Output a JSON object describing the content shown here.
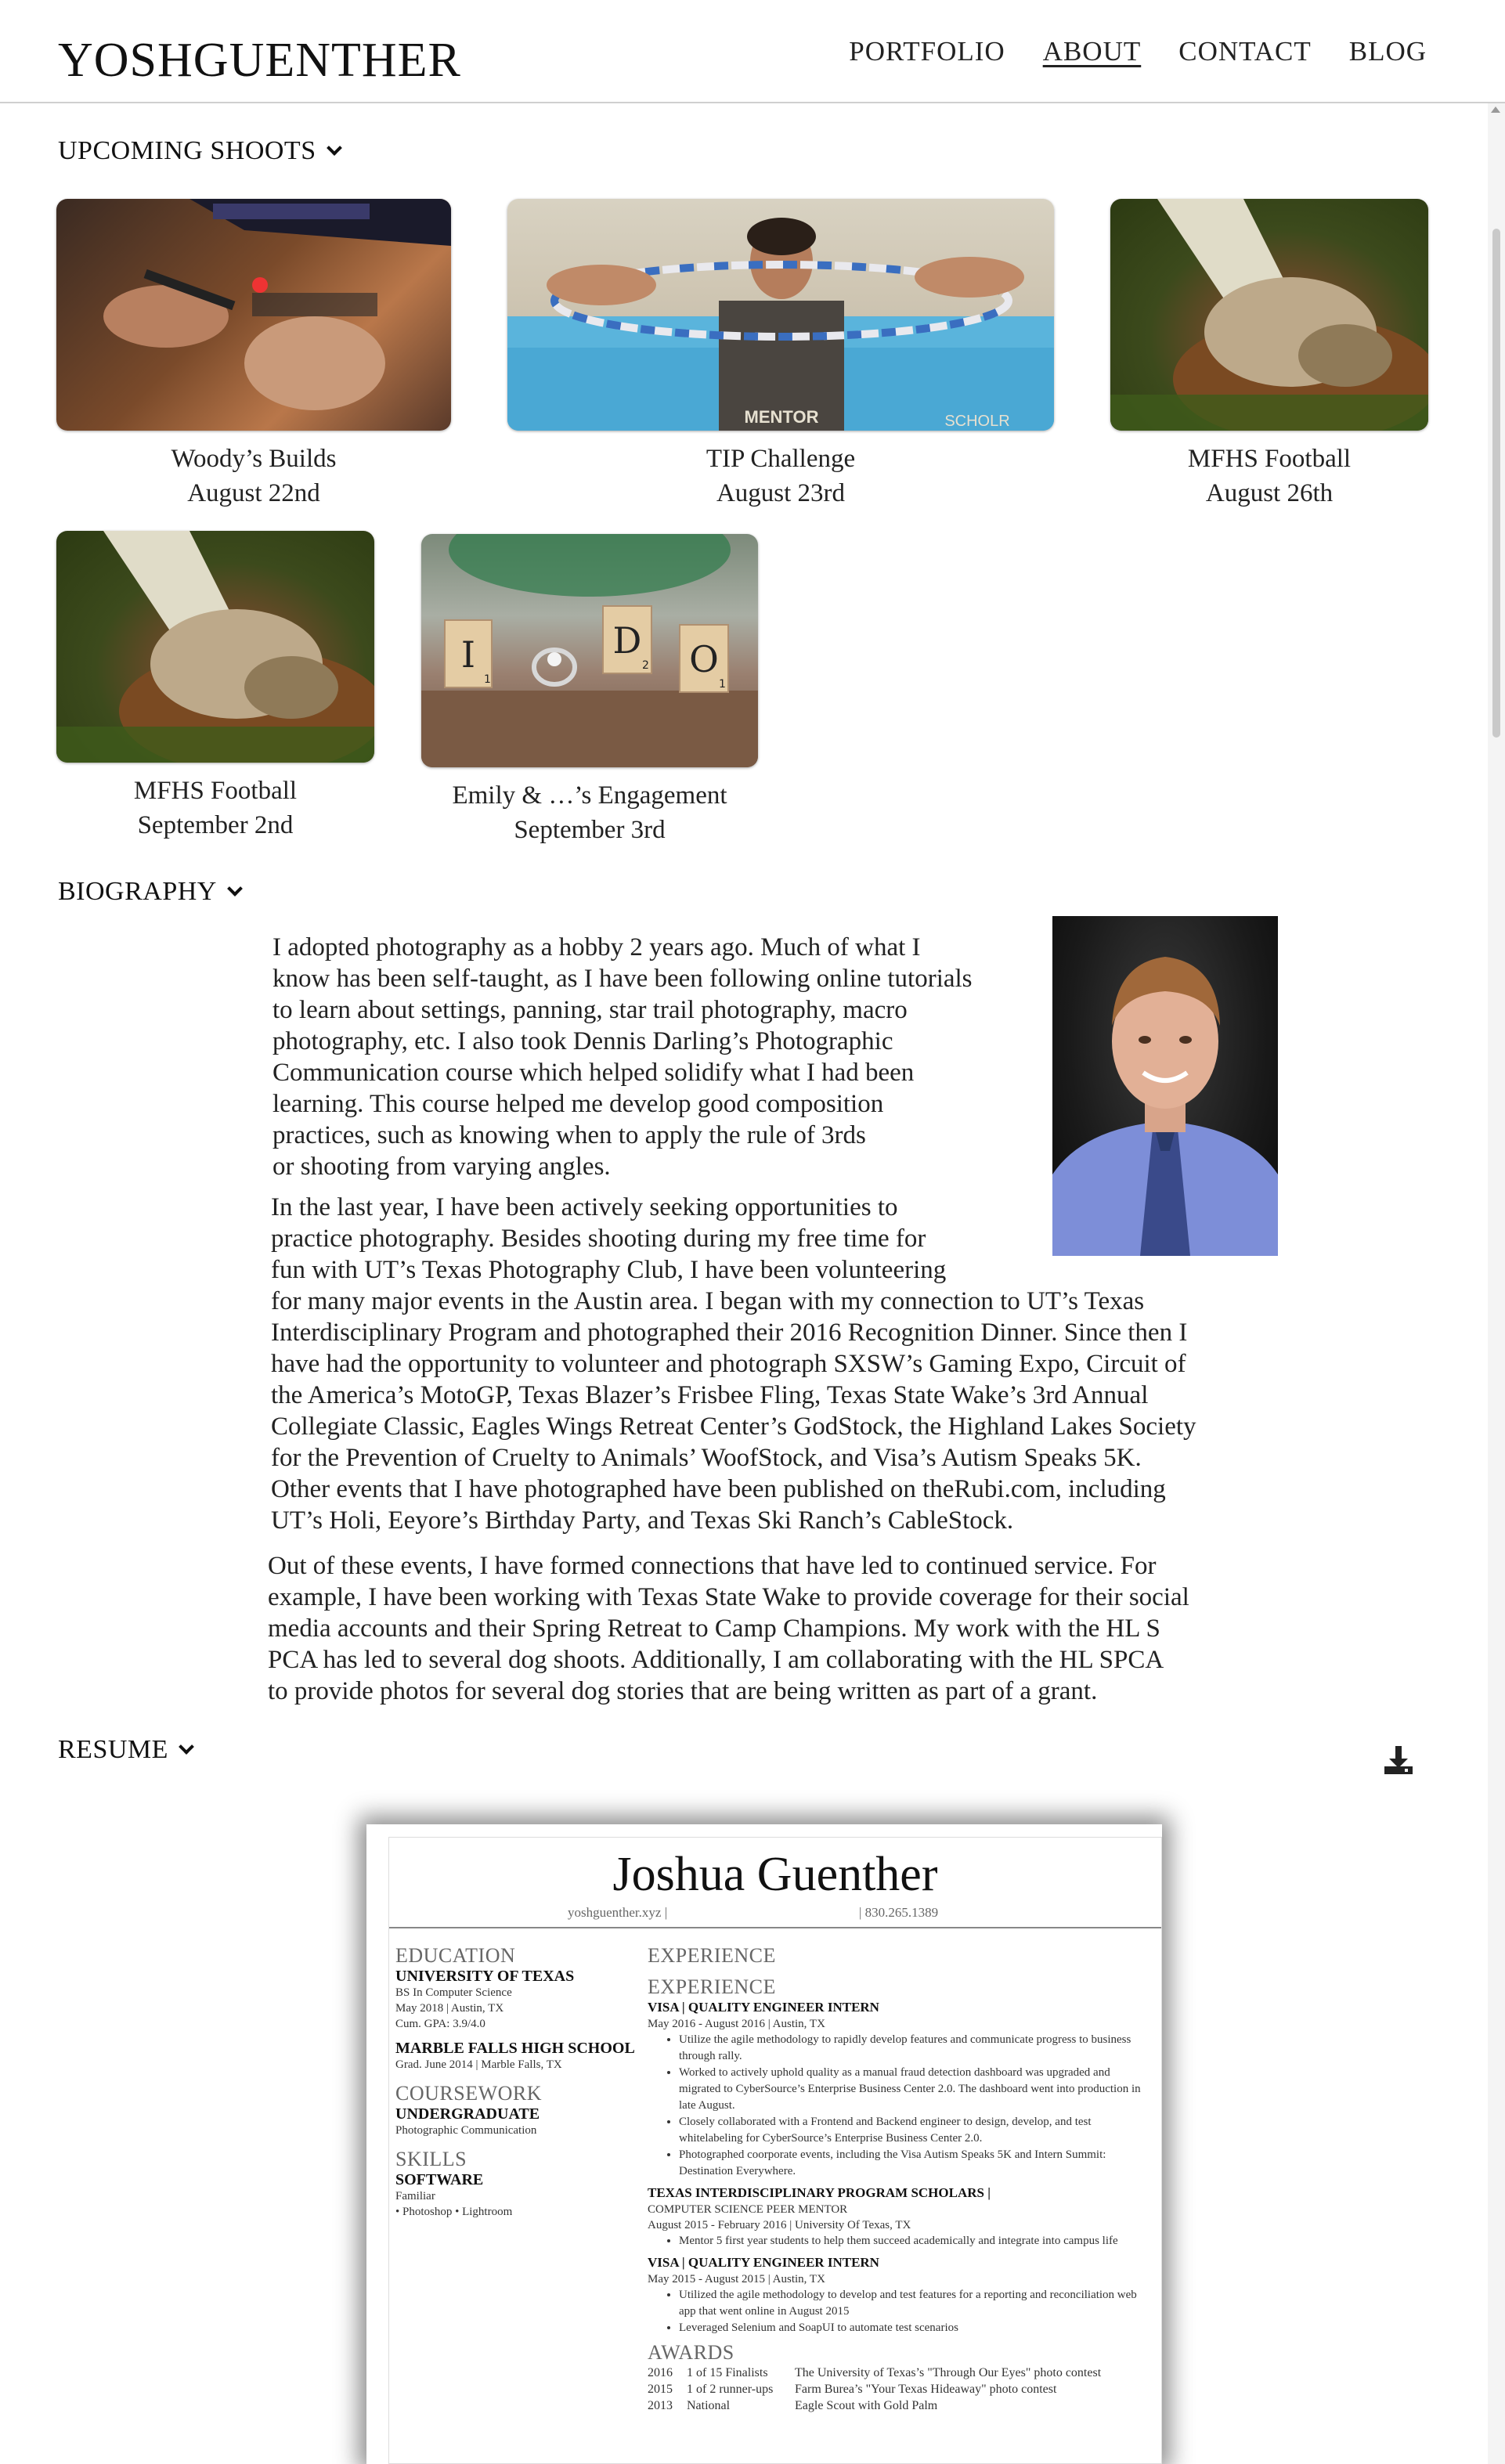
{
  "header": {
    "site_title": "YOSHGUENTHER",
    "nav": [
      "PORTFOLIO",
      "ABOUT",
      "CONTACT",
      "BLOG"
    ]
  },
  "sections": {
    "upcoming": "UPCOMING SHOOTS",
    "biography": "BIOGRAPHY",
    "resume": "RESUME"
  },
  "shoots": [
    {
      "title": "Woody’s Builds",
      "date": "August 22nd"
    },
    {
      "title": "TIP Challenge",
      "date": "August 23rd"
    },
    {
      "title": "MFHS Football",
      "date": "August 26th"
    },
    {
      "title": "MFHS Football",
      "date": "September 2nd"
    },
    {
      "title": "Emily & …’s Engagement",
      "date": "September 3rd"
    }
  ],
  "photo_text": {
    "tip_shirt": "MENTOR",
    "tip_scholar": "SCHOLR",
    "tile_letters": [
      "I",
      "D",
      "O"
    ],
    "tile_numbers": [
      "1",
      "2",
      "1"
    ]
  },
  "biography": {
    "p1_lines": [
      " I adopted photography as a hobby 2 years ago. Much of what I",
      "know has been self-taught, as I have been following online tutorials",
      "to learn about settings, panning, star trail photography, macro",
      "photography, etc. I also took Dennis Darling’s Photographic",
      "Communication course which helped solidify what I had been",
      "learning. This course helped me develop good composition",
      "practices, such as knowing when to apply the rule of 3rds",
      "or shooting from varying angles."
    ],
    "p2_lines": [
      "In the last year, I have been actively seeking opportunities to",
      "practice photography.  Besides shooting during my free time for",
      "fun with UT’s Texas Photography Club, I have been volunteering",
      "for many major events in the Austin area. I began with my connection to UT’s Texas",
      "Interdisciplinary Program and photographed their 2016 Recognition Dinner. Since then I",
      "have had the opportunity to volunteer and photograph SXSW’s Gaming Expo, Circuit of",
      "the America’s MotoGP, Texas Blazer’s Frisbee Fling, Texas State Wake’s 3rd Annual",
      "Collegiate Classic, Eagles Wings Retreat Center’s GodStock, the Highland Lakes Society",
      "for the Prevention of Cruelty to Animals’ WoofStock, and Visa’s Autism Speaks 5K.",
      "Other events that I have photographed have been published on theRubi.com, including",
      "UT’s Holi, Eeyore’s Birthday Party, and Texas Ski Ranch’s CableStock."
    ],
    "p3_lines": [
      "Out of these events, I have formed connections that have led to continued service. For",
      "example, I have been working with Texas State Wake to provide coverage for their social",
      "media accounts and their Spring Retreat to Camp Champions. My work with the HL S",
      "PCA has led to several dog shoots. Additionally, I am collaborating with the HL SPCA",
      "to provide photos for several dog stories that are being written as part of a grant."
    ]
  },
  "resume": {
    "name": "Joshua Guenther",
    "contact_left": "yoshguenther.xyz |",
    "contact_right": "| 830.265.1389",
    "education_h": "EDUCATION",
    "ut": "UNIVERSITY OF TEXAS",
    "ut_lines": [
      "BS In Computer Science",
      "May 2018 | Austin, TX",
      "Cum. GPA: 3.9/4.0"
    ],
    "mfhs": "MARBLE FALLS HIGH SCHOOL",
    "mfhs_line": "Grad. June 2014 | Marble Falls, TX",
    "coursework_h": "COURSEWORK",
    "undergrad": "UNDERGRADUATE",
    "undergrad_line": "Photographic Communication",
    "skills_h": "SKILLS",
    "software": "SOFTWARE",
    "software_lines": [
      "Familiar",
      "• Photoshop • Lightroom"
    ],
    "experience_h1": "EXPERIENCE",
    "experience_h2": "EXPERIENCE",
    "visa1": "VISA | QUALITY ENGINEER INTERN",
    "visa1_date": "May 2016 - August 2016 | Austin, TX",
    "visa1_bullets": [
      "Utilize the agile methodology to rapidly develop features and communicate progress to business through rally.",
      "Worked to actively uphold quality as a manual fraud detection dashboard was upgraded and migrated to CyberSource’s Enterprise Business Center 2.0. The dashboard went into production in late August.",
      "Closely collaborated with a Frontend and Backend engineer to design, develop, and test whitelabeling for CyberSource’s Enterprise Business Center 2.0.",
      "Photographed coorporate events, including the Visa Autism Speaks 5K and Intern Summit: Destination Everywhere."
    ],
    "tip": "TEXAS INTERDISCIPLINARY PROGRAM SCHOLARS |",
    "tip_role": "COMPUTER SCIENCE PEER MENTOR",
    "tip_date": "August 2015 - February 2016 | University Of Texas, TX",
    "tip_bullets": [
      "Mentor 5 first year students to help them succeed academically and integrate into campus life"
    ],
    "visa2": "VISA | QUALITY ENGINEER INTERN",
    "visa2_date": "May 2015 - August 2015 | Austin, TX",
    "visa2_bullets": [
      "Utilized the agile methodology to develop and test features for a reporting and reconciliation web app that went online in August 2015",
      "Leveraged Selenium and SoapUI to automate test scenarios"
    ],
    "awards_h": "AWARDS",
    "awards": [
      [
        "2016",
        "1 of 15 Finalists",
        "The University of Texas’s \"Through Our Eyes\" photo contest"
      ],
      [
        "2015",
        "1 of 2 runner-ups",
        "Farm Burea’s \"Your Texas Hideaway\" photo contest"
      ],
      [
        "2013",
        "National",
        "Eagle Scout with Gold Palm"
      ]
    ]
  }
}
